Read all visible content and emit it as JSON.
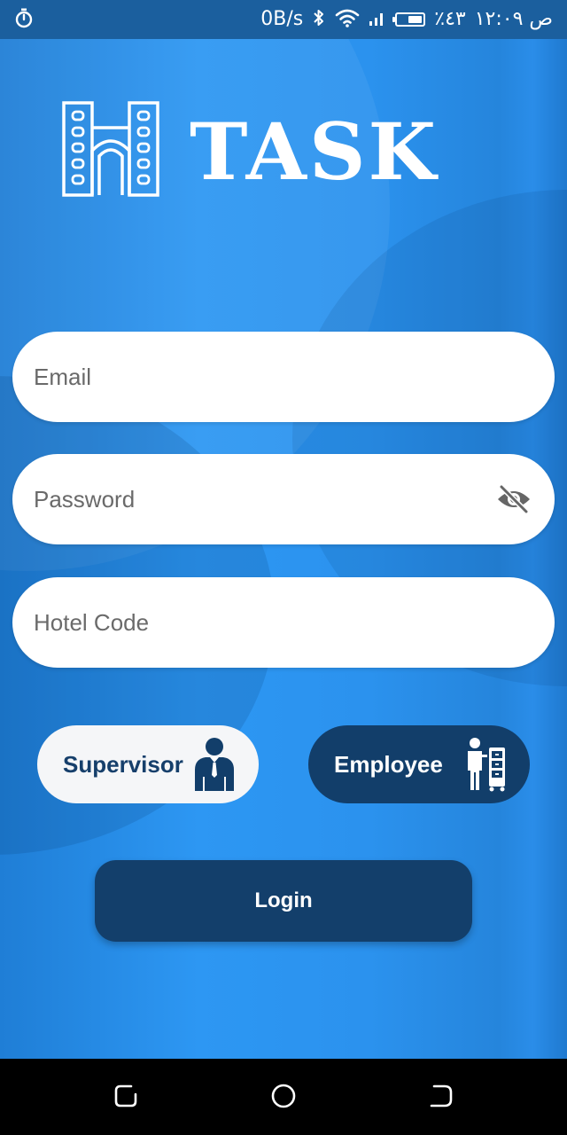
{
  "status_bar": {
    "timer_icon": "stopwatch-icon",
    "network_speed": "0B/s",
    "bluetooth_icon": "bluetooth-icon",
    "wifi_icon": "wifi-icon",
    "signal_icon": "signal-icon",
    "battery_level": 0.6,
    "battery_percent": "٪٤٣",
    "time": "ص ١٢:٠٩"
  },
  "app": {
    "logo_icon": "hotel-building-icon",
    "logo_text": "TASK",
    "colors": {
      "background": "#2b92ee",
      "dark_navy": "#133f6b",
      "field_bg": "#ffffff",
      "placeholder": "#6a6a6a"
    }
  },
  "form": {
    "email": {
      "placeholder": "Email",
      "value": ""
    },
    "password": {
      "placeholder": "Password",
      "value": "",
      "toggle_icon": "eye-off-icon"
    },
    "hotel_code": {
      "placeholder": "Hotel Code",
      "value": ""
    }
  },
  "roles": {
    "supervisor": {
      "label": "Supervisor",
      "icon": "supervisor-icon",
      "selected": false
    },
    "employee": {
      "label": "Employee",
      "icon": "employee-icon",
      "selected": true
    }
  },
  "login_button": {
    "label": "Login"
  },
  "nav_bar": {
    "recents_icon": "recents-icon",
    "home_icon": "home-icon",
    "back_icon": "back-icon"
  }
}
